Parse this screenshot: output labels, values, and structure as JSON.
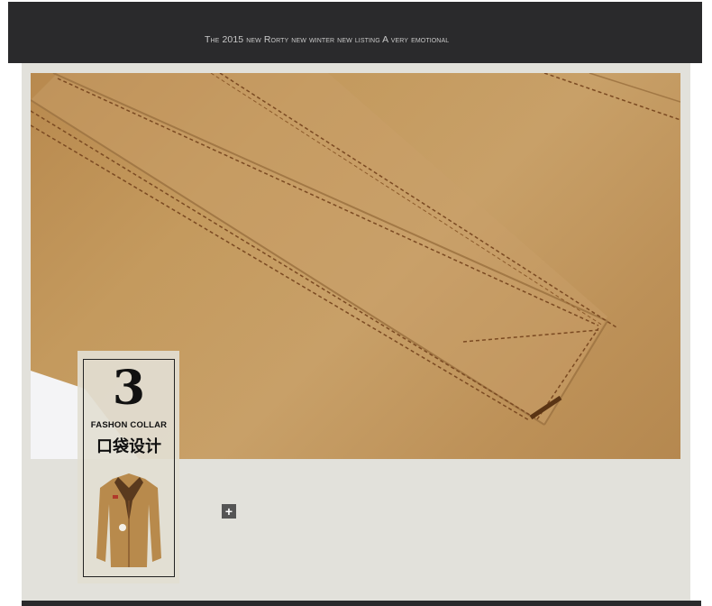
{
  "header": {
    "tagline": "The 2015 new Rorty new winter new listing  A very emotional"
  },
  "badge": {
    "number": "3",
    "title_en": "FASHON COLLAR",
    "title_cn": "口袋设计"
  },
  "photo": {
    "subject": "jacket-pocket-closeup"
  },
  "icons": {
    "expand": "plus-icon"
  },
  "colors": {
    "header_bg": "#2a2a2c",
    "panel_bg": "#e2e1db",
    "fabric": "#c49a5e"
  }
}
